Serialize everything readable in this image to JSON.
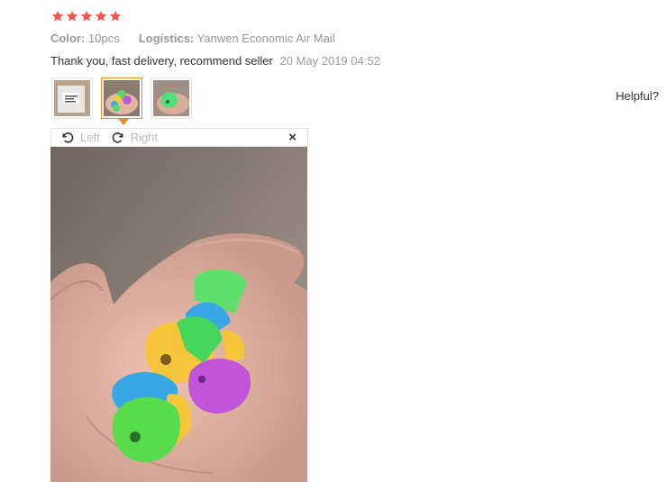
{
  "rating": {
    "stars": 5,
    "star_color": "#f0564a"
  },
  "meta": {
    "color_label": "Color:",
    "color_value": "10pcs",
    "logistics_label": "Logistics:",
    "logistics_value": "Yanwen Economic Air Mail"
  },
  "review": {
    "text": "Thank you, fast delivery, recommend seller",
    "date": "20 May 2019 04:52"
  },
  "thumbnails": [
    {
      "name": "package-photo"
    },
    {
      "name": "hand-with-caps-photo",
      "selected": true
    },
    {
      "name": "green-cap-photo"
    }
  ],
  "helpful_label": "Helpful?",
  "viewer": {
    "rotate_left_label": "Left",
    "rotate_right_label": "Right",
    "close_icon": "×"
  },
  "colors": {
    "accent": "#f08a24",
    "muted": "#999999"
  }
}
